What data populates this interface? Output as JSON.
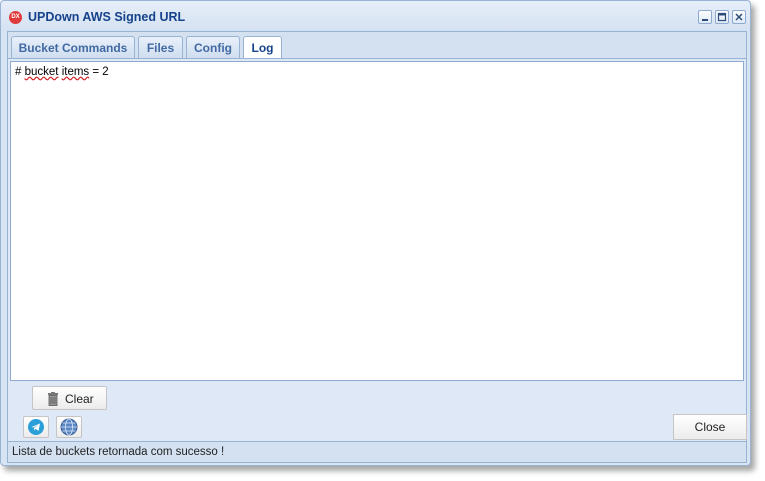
{
  "window": {
    "title": "UPDown AWS Signed URL",
    "logo_text": "DX",
    "minimize_icon": "minimize-icon",
    "maximize_icon": "maximize-icon",
    "close_icon": "close-icon"
  },
  "tabs": [
    {
      "label": "Bucket Commands",
      "active": false
    },
    {
      "label": "Files",
      "active": false
    },
    {
      "label": "Config",
      "active": false
    },
    {
      "label": "Log",
      "active": true
    }
  ],
  "log": {
    "prefix": "# ",
    "word1": "bucket",
    "space": " ",
    "word2": "items",
    "suffix": " = 2"
  },
  "buttons": {
    "clear_label": "Clear",
    "close_label": "Close",
    "telegram_icon": "telegram-icon",
    "web_icon": "www-icon",
    "trash_icon": "trash-icon"
  },
  "status": {
    "text": "Lista de buckets retornada com sucesso !"
  },
  "colors": {
    "accent": "#15428b",
    "frame": "#d7e4f3",
    "telegram": "#2a9fd8"
  }
}
